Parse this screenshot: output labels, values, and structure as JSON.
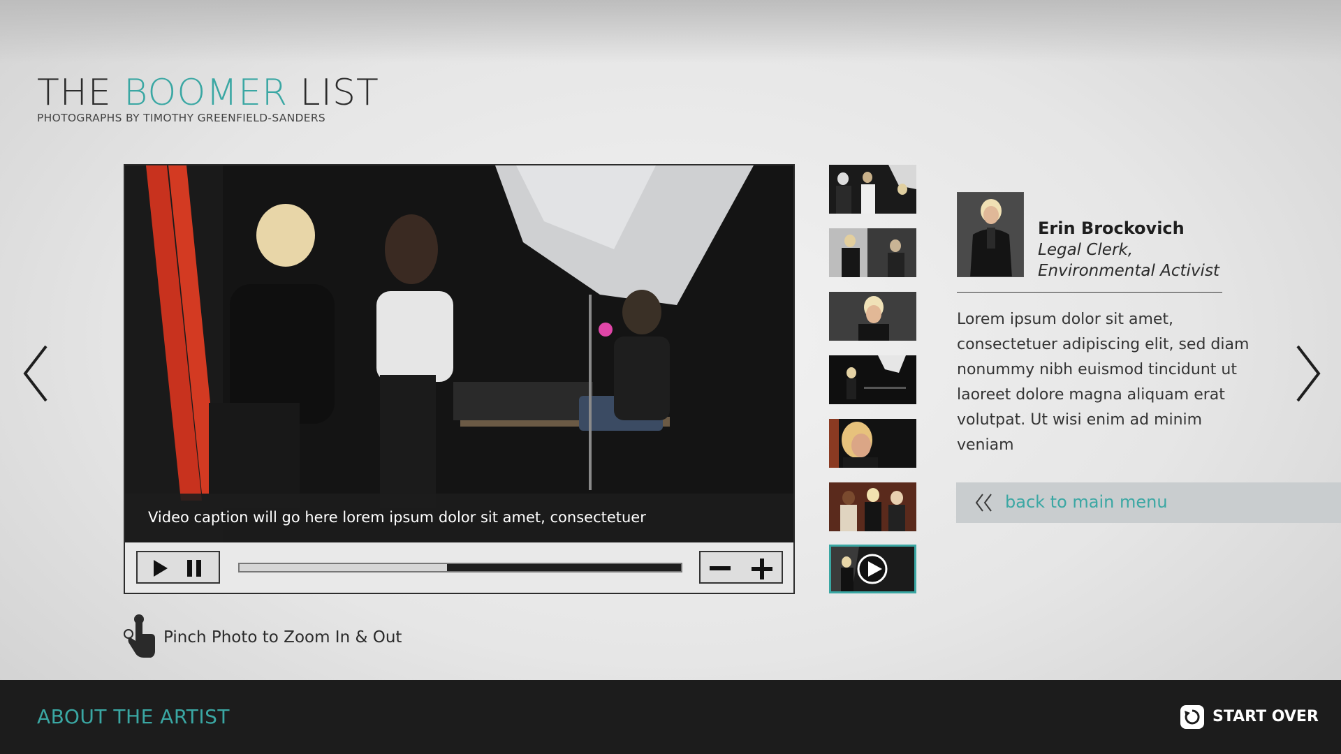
{
  "header": {
    "title_part1": "THE ",
    "title_accent": "BOOMER",
    "title_part2": " LIST",
    "subtitle": "PHOTOGRAPHS BY TIMOTHY GREENFIELD-SANDERS"
  },
  "player": {
    "caption": "Video caption will go here lorem ipsum dolor sit amet, consectetuer",
    "progress_fraction": 0.47
  },
  "thumbnails": [
    {
      "icon": "photo-thumbnail"
    },
    {
      "icon": "photo-thumbnail"
    },
    {
      "icon": "photo-thumbnail"
    },
    {
      "icon": "photo-thumbnail"
    },
    {
      "icon": "photo-thumbnail"
    },
    {
      "icon": "photo-thumbnail"
    },
    {
      "icon": "video-thumbnail",
      "active": true
    }
  ],
  "profile": {
    "name": "Erin Brockovich",
    "role_line1": "Legal Clerk,",
    "role_line2": "Environmental Activist",
    "bio": "Lorem ipsum dolor sit amet, consectetuer adipiscing elit, sed diam nonummy nibh euismod tincidunt ut laoreet dolore magna aliquam erat volutpat. Ut wisi enim ad minim veniam",
    "back_label": "back to main menu"
  },
  "hint": {
    "text": "Pinch Photo to Zoom In & Out"
  },
  "footer": {
    "about_label": "ABOUT THE ARTIST",
    "start_over_label": "START OVER"
  },
  "colors": {
    "accent": "#3aa7a3",
    "footer_bg": "#1c1c1c"
  }
}
